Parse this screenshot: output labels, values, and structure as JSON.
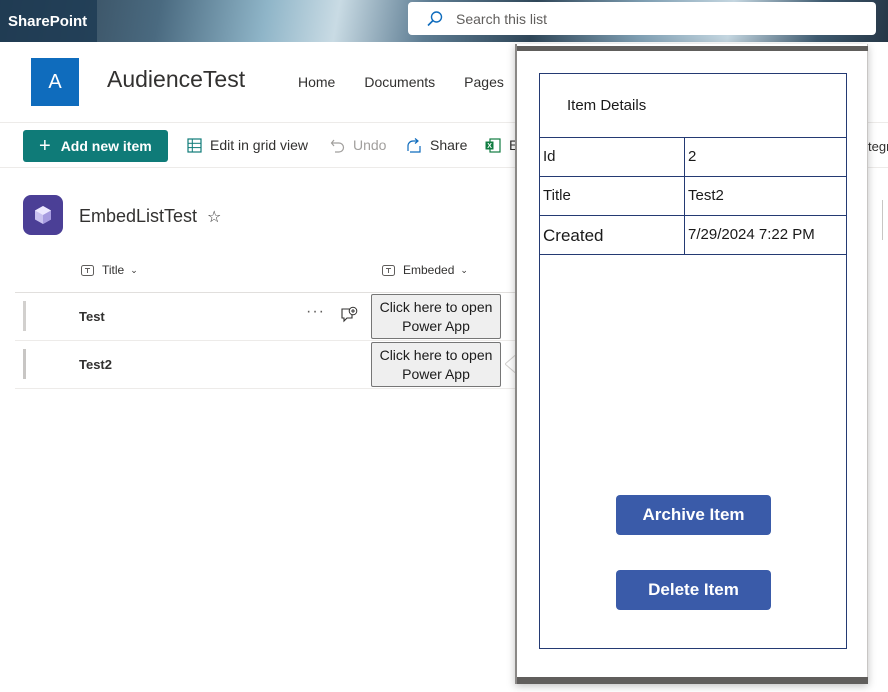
{
  "suitebar": {
    "brand": "SharePoint",
    "search_placeholder": "Search this list"
  },
  "site": {
    "logo_letter": "A",
    "title": "AudienceTest",
    "nav": [
      "Home",
      "Documents",
      "Pages"
    ]
  },
  "commandbar": {
    "add_new": "Add new item",
    "edit_grid": "Edit in grid view",
    "undo": "Undo",
    "share": "Share",
    "export_fragment": "E",
    "right_fragment": "tegr"
  },
  "list": {
    "title": "EmbedListTest",
    "columns": [
      "Title",
      "Embeded"
    ],
    "rows": [
      {
        "title": "Test",
        "embed_label": "Click here to open Power App"
      },
      {
        "title": "Test2",
        "embed_label": "Click here to open Power App"
      }
    ]
  },
  "popup": {
    "header": "Item Details",
    "fields": [
      {
        "label": "Id",
        "value": "2"
      },
      {
        "label": "Title",
        "value": "Test2"
      },
      {
        "label": "Created",
        "value": "7/29/2024 7:22 PM"
      }
    ],
    "archive_button": "Archive Item",
    "delete_button": "Delete Item"
  },
  "colors": {
    "add_button": "#0f7b78",
    "site_logo": "#0f6cbd",
    "list_icon": "#4b3f96",
    "powerapp_button": "#3a5ba9",
    "card_border": "#243a73"
  }
}
